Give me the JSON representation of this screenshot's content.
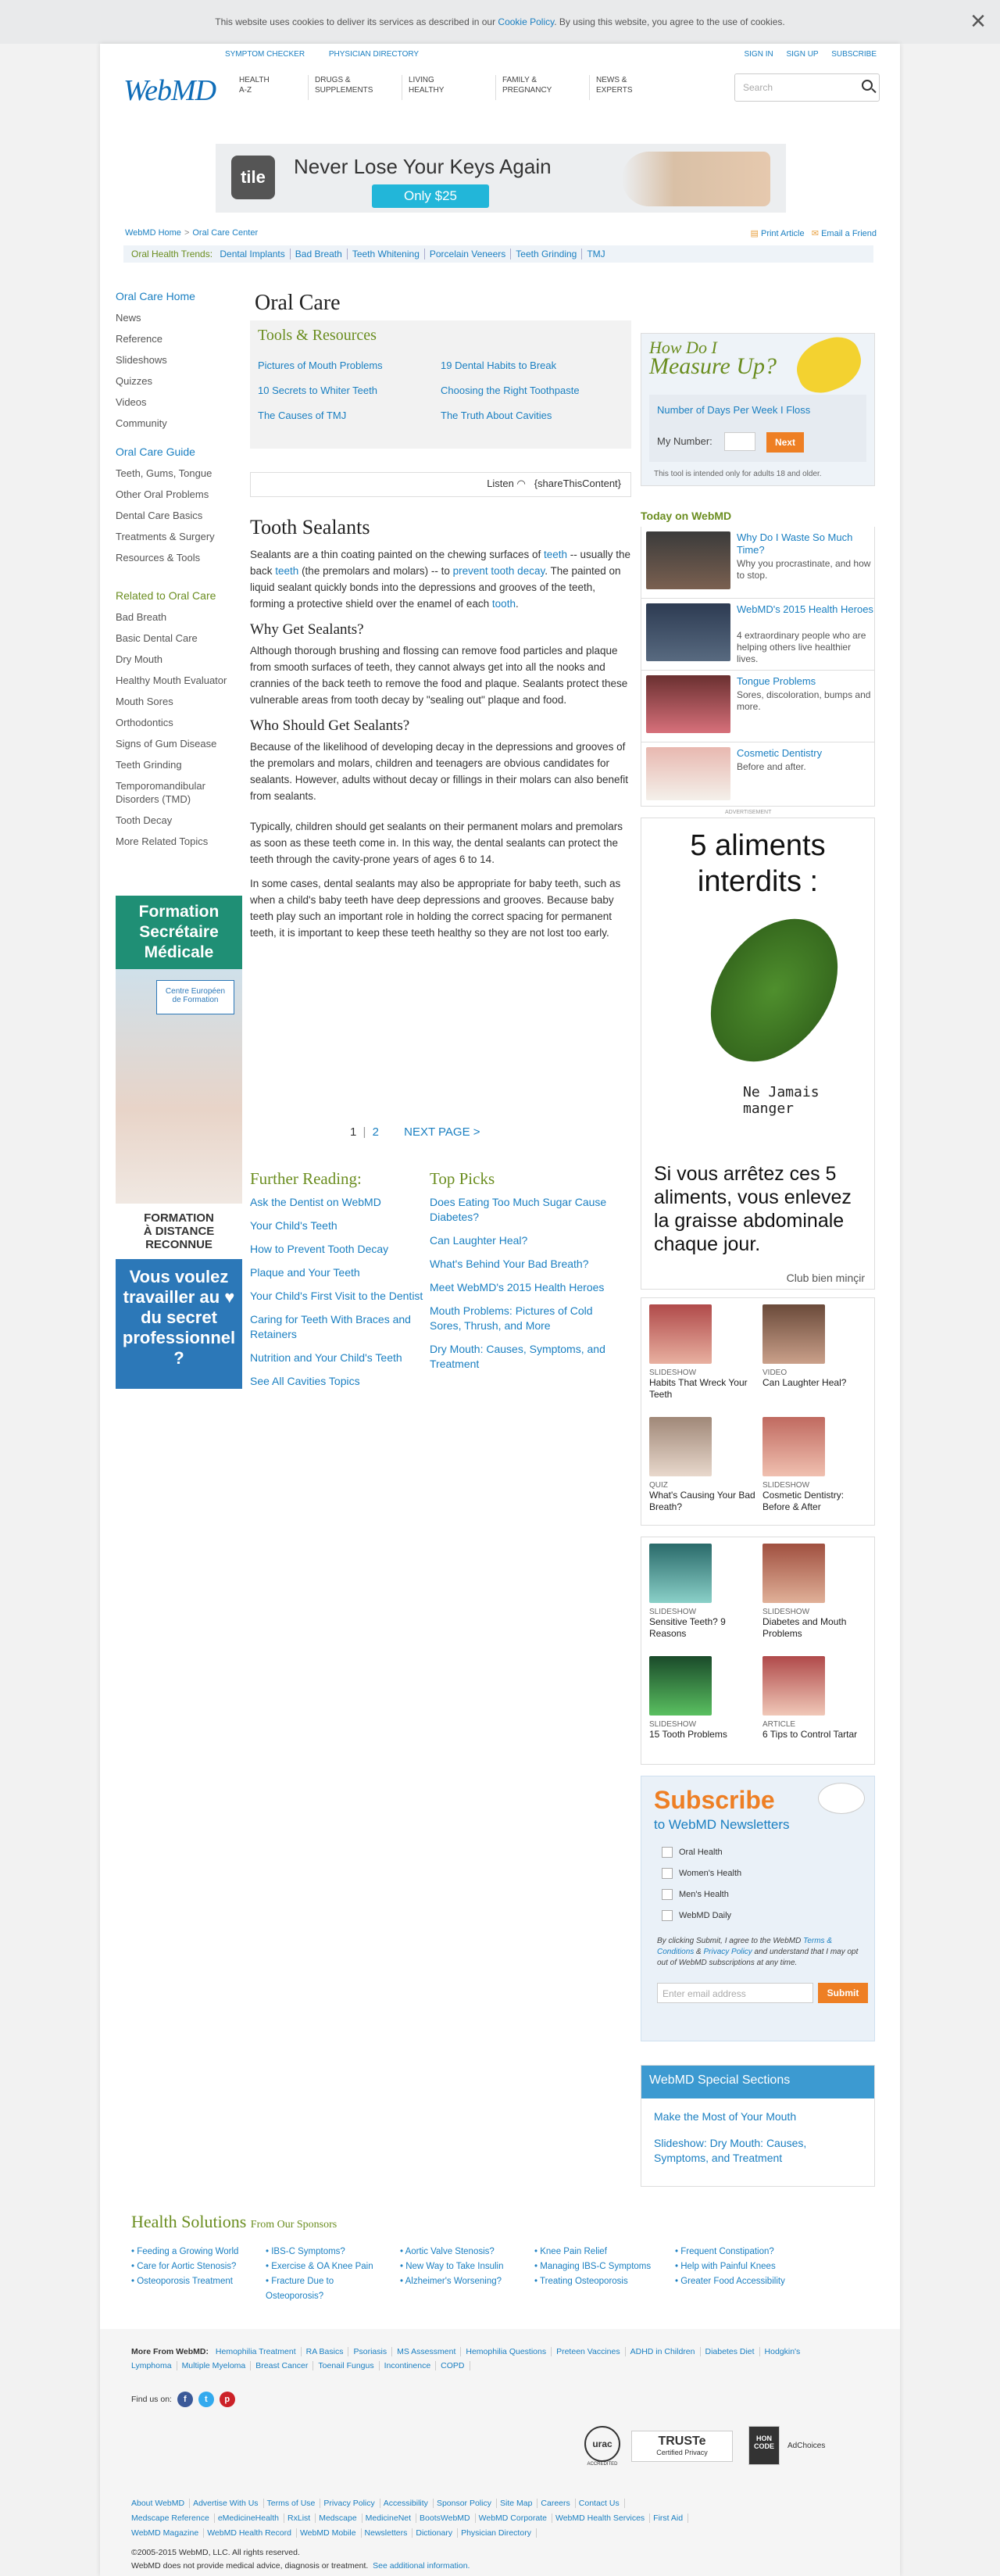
{
  "cookie": {
    "pre": "This website uses cookies to deliver its services as described in our ",
    "link": "Cookie Policy",
    "post": ". By using this website, you agree to the use of cookies.",
    "close": "×"
  },
  "header": {
    "top_links": [
      "SYMPTOM CHECKER",
      "PHYSICIAN DIRECTORY"
    ],
    "user_links": [
      "SIGN IN",
      "SIGN UP",
      "SUBSCRIBE"
    ],
    "logo": "WebMD",
    "nav": [
      [
        "HEALTH",
        "A-Z"
      ],
      [
        "DRUGS &",
        "SUPPLEMENTS"
      ],
      [
        "LIVING",
        "HEALTHY"
      ],
      [
        "FAMILY &",
        "PREGNANCY"
      ],
      [
        "NEWS &",
        "EXPERTS"
      ]
    ],
    "search_placeholder": "Search"
  },
  "ad_top": {
    "brand": "tile",
    "headline": "Never Lose Your Keys Again",
    "cta": "Only $25"
  },
  "breadcrumb": [
    "WebMD Home",
    "Oral Care Center"
  ],
  "page_tools": [
    "Print Article",
    "Email a Friend"
  ],
  "trends": {
    "label": "Oral Health Trends:",
    "items": [
      "Dental Implants",
      "Bad Breath",
      "Teeth Whitening",
      "Porcelain Veneers",
      "Teeth Grinding",
      "TMJ"
    ]
  },
  "leftnav": {
    "head1": "Oral Care Home",
    "items1": [
      "News",
      "Reference",
      "Slideshows",
      "Quizzes",
      "Videos",
      "Community"
    ],
    "head2": "Oral Care Guide",
    "items2": [
      "Teeth, Gums, Tongue",
      "Other Oral Problems",
      "Dental Care Basics",
      "Treatments & Surgery",
      "Resources & Tools"
    ],
    "head3": "Related to Oral Care",
    "items3": [
      "Bad Breath",
      "Basic Dental Care",
      "Dry Mouth",
      "Healthy Mouth Evaluator",
      "Mouth Sores",
      "Orthodontics",
      "Signs of Gum Disease",
      "Teeth Grinding",
      "Temporomandibular Disorders (TMD)",
      "Tooth Decay",
      "More Related Topics"
    ]
  },
  "ad_left": {
    "title": "Formation Secrétaire Médicale",
    "logo_line1": "Centre Européen",
    "logo_line2": "de Formation",
    "fd1": "FORMATION",
    "fd2": "À DISTANCE",
    "fd3": "RECONNUE",
    "blue": "Vous voulez travailler au ♥ du secret professionnel ?"
  },
  "page_title": "Oral Care",
  "tools": {
    "heading": "Tools & Resources",
    "links": [
      "Pictures of Mouth Problems",
      "10 Secrets to Whiter Teeth",
      "The Causes of TMJ",
      "19 Dental Habits to Break",
      "Choosing the Right Toothpaste",
      "The Truth About Cavities"
    ]
  },
  "listen": {
    "label": "Listen",
    "share": "{shareThisContent}"
  },
  "article": {
    "title": "Tooth Sealants",
    "p1a": "Sealants are a thin coating painted on the chewing surfaces of ",
    "p1_teeth": "teeth",
    "p1b": " -- usually the back ",
    "p1_teeth2": "teeth",
    "p1c": " (the premolars and molars) -- to ",
    "p1_decay": "prevent tooth decay",
    "p1d": ". The painted on liquid sealant quickly bonds into the depressions and grooves of the teeth, forming a protective shield over the enamel of each ",
    "p1_tooth": "tooth",
    "p1e": ".",
    "h_why": "Why Get Sealants?",
    "p2": "Although thorough brushing and flossing can remove food particles and plaque from smooth surfaces of teeth, they cannot always get into all the nooks and crannies of the back teeth to remove the food and plaque. Sealants protect these vulnerable areas from tooth decay by \"sealing out\" plaque and food.",
    "h_who": "Who Should Get Sealants?",
    "p3": "Because of the likelihood of developing decay in the depressions and grooves of the premolars and molars, children and teenagers are obvious candidates for sealants. However, adults without decay or fillings in their molars can also benefit from sealants.",
    "p4": "Typically, children should get sealants on their permanent molars and premolars as soon as these teeth come in. In this way, the dental sealants can protect the teeth through the cavity-prone years of ages 6 to 14.",
    "p5": "In some cases, dental sealants may also be appropriate for baby teeth, such as when a child's baby teeth have deep depressions and grooves. Because baby teeth play such an important role in holding the correct spacing for permanent teeth, it is important to keep these teeth healthy so they are not lost too early."
  },
  "pager": {
    "current": "1",
    "sep": "|",
    "next_page": "2",
    "next": "NEXT PAGE >"
  },
  "further": {
    "heading": "Further Reading:",
    "items": [
      "Ask the Dentist on WebMD",
      "Your Child's Teeth",
      "How to Prevent Tooth Decay",
      "Plaque and Your Teeth",
      "Your Child's First Visit to the Dentist",
      "Caring for Teeth With Braces and Retainers",
      "Nutrition and Your Child's Teeth",
      "See All Cavities Topics"
    ]
  },
  "picks": {
    "heading": "Top Picks",
    "items": [
      "Does Eating Too Much Sugar Cause Diabetes?",
      "Can Laughter Heal?",
      "What's Behind Your Bad Breath?",
      "Meet WebMD's 2015 Health Heroes",
      "Mouth Problems: Pictures of Cold Sores, Thrush, and More",
      "Dry Mouth: Causes, Symptoms, and Treatment"
    ]
  },
  "measure": {
    "h1": "How Do I",
    "h2": "Measure Up?",
    "question": "Number of Days Per Week I Floss",
    "label": "My Number:",
    "next": "Next",
    "note": "This tool is intended only for adults 18 and older."
  },
  "today": {
    "heading": "Today on WebMD",
    "items": [
      {
        "title": "Why Do I Waste So Much Time?",
        "desc": "Why you procrastinate, and how to stop."
      },
      {
        "title": "WebMD's 2015 Health Heroes",
        "desc": "4 extraordinary people who are helping others live healthier lives."
      },
      {
        "title": "Tongue Problems",
        "desc": "Sores, discoloration, bumps and more."
      },
      {
        "title": "Cosmetic Dentistry",
        "desc": "Before and after."
      }
    ]
  },
  "ad_right": {
    "title": "5 aliments interdits :",
    "nj": "Ne Jamais manger",
    "body": "Si vous arrêtez ces 5 aliments, vous enlevez la graisse abdominale chaque jour.",
    "brand": "Club bien minçir"
  },
  "ad_label": "ADVERTISEMENT",
  "grid1": [
    {
      "kind": "SLIDESHOW",
      "title": "Habits That Wreck Your Teeth"
    },
    {
      "kind": "VIDEO",
      "title": "Can Laughter Heal?"
    },
    {
      "kind": "QUIZ",
      "title": "What's Causing Your Bad Breath?"
    },
    {
      "kind": "SLIDESHOW",
      "title": "Cosmetic Dentistry: Before & After"
    }
  ],
  "grid2": [
    {
      "kind": "SLIDESHOW",
      "title": "Sensitive Teeth? 9 Reasons"
    },
    {
      "kind": "SLIDESHOW",
      "title": "Diabetes and Mouth Problems"
    },
    {
      "kind": "SLIDESHOW",
      "title": "15 Tooth Problems"
    },
    {
      "kind": "ARTICLE",
      "title": "6 Tips to Control Tartar"
    }
  ],
  "subscribe": {
    "heading": "Subscribe",
    "sub": "to WebMD Newsletters",
    "options": [
      "Oral Health",
      "Women's Health",
      "Men's Health",
      "WebMD Daily"
    ],
    "legal_a": "By clicking Submit, I agree to the WebMD ",
    "terms": "Terms & Conditions",
    "amp": " & ",
    "privacy": "Privacy Policy",
    "legal_b": " and understand that I may opt out of WebMD subscriptions at any time.",
    "placeholder": "Enter email address",
    "submit": "Submit"
  },
  "special": {
    "heading": "WebMD Special Sections",
    "links": [
      "Make the Most of Your Mouth",
      "Slideshow: Dry Mouth: Causes, Symptoms, and Treatment"
    ]
  },
  "health_solutions": {
    "heading": "Health Solutions",
    "sub": "From Our Sponsors",
    "cols": [
      [
        "Feeding a Growing World",
        "Care for Aortic Stenosis?",
        "Osteoporosis Treatment"
      ],
      [
        "IBS-C Symptoms?",
        "Exercise & OA Knee Pain",
        "Fracture Due to Osteoporosis?"
      ],
      [
        "Aortic Valve Stenosis?",
        "New Way to Take Insulin",
        "Alzheimer's Worsening?"
      ],
      [
        "Knee Pain Relief",
        "Managing IBS-C Symptoms",
        "Treating Osteoporosis"
      ],
      [
        "Frequent Constipation?",
        "Help with Painful Knees",
        "Greater Food Accessibility"
      ]
    ]
  },
  "footer": {
    "more_label": "More From WebMD:",
    "more": [
      "Hemophilia Treatment",
      "RA Basics",
      "Psoriasis",
      "MS Assessment",
      "Hemophilia Questions",
      "Preteen Vaccines",
      "ADHD in Children",
      "Diabetes Diet",
      "Hodgkin's Lymphoma",
      "Multiple Myeloma",
      "Breast Cancer",
      "Toenail Fungus",
      "Incontinence",
      "COPD"
    ],
    "find": "Find us on:",
    "badges": {
      "urac": "urac",
      "urac_sub": "ACCREDITED",
      "truste": "TRUSTe",
      "truste_sub": "Certified Privacy",
      "hon": "HON CODE",
      "adchoices": "AdChoices"
    },
    "links": [
      "About WebMD",
      "Advertise With Us",
      "Terms of Use",
      "Privacy Policy",
      "Accessibility",
      "Sponsor Policy",
      "Site Map",
      "Careers",
      "Contact Us",
      "Medscape Reference",
      "eMedicineHealth",
      "RxList",
      "Medscape",
      "MedicineNet",
      "BootsWebMD",
      "WebMD Corporate",
      "WebMD Health Services",
      "First Aid",
      "WebMD Magazine",
      "WebMD Health Record",
      "WebMD Mobile",
      "Newsletters",
      "Dictionary",
      "Physician Directory"
    ],
    "copy1": "©2005-2015 WebMD, LLC. All rights reserved.",
    "copy2": "WebMD does not provide medical advice, diagnosis or treatment.",
    "copy3": "See additional information."
  }
}
